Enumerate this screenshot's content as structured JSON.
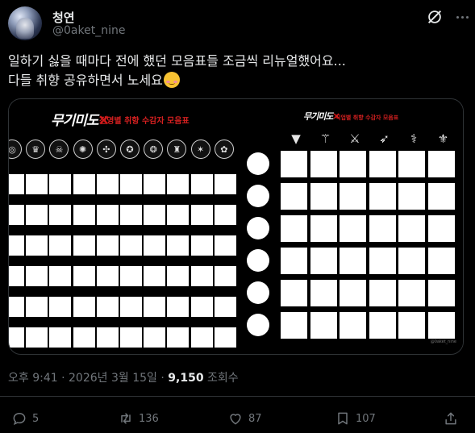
{
  "author": {
    "name": "청연",
    "handle": "@0aket_nine"
  },
  "post": {
    "line1": "일하기 싫을 때마다 전에 했던 모음표들 조금씩 리뉴얼했어요...",
    "line2": "다들 취향 공유하면서 노세요"
  },
  "media": {
    "left_logo": "무기미도",
    "left_title": "진영별 취향 수감자 모음표",
    "right_logo": "무기미도",
    "right_title": "직업별 취향 수감자 모음표",
    "emblems": [
      "emblem-1",
      "emblem-2",
      "emblem-3",
      "emblem-4",
      "emblem-5",
      "emblem-6",
      "emblem-7",
      "emblem-8",
      "emblem-9",
      "emblem-10"
    ],
    "weapon_icons": [
      "shield-icon",
      "trident-icon",
      "crossed-swords-icon",
      "bow-icon",
      "wand-icon",
      "staff-icon"
    ],
    "footnote": "@0aket_nine"
  },
  "meta": {
    "time": "오후 9:41",
    "date": "2026년 3월 15일",
    "sep": "·",
    "views_count": "9,150",
    "views_label": "조회수"
  },
  "actions": {
    "replies": "5",
    "reposts": "136",
    "likes": "87",
    "bookmarks": "107"
  },
  "colors": {
    "accent_red": "#d42020",
    "muted": "#71767b",
    "text": "#e7e9ea",
    "border": "#2f3336"
  }
}
